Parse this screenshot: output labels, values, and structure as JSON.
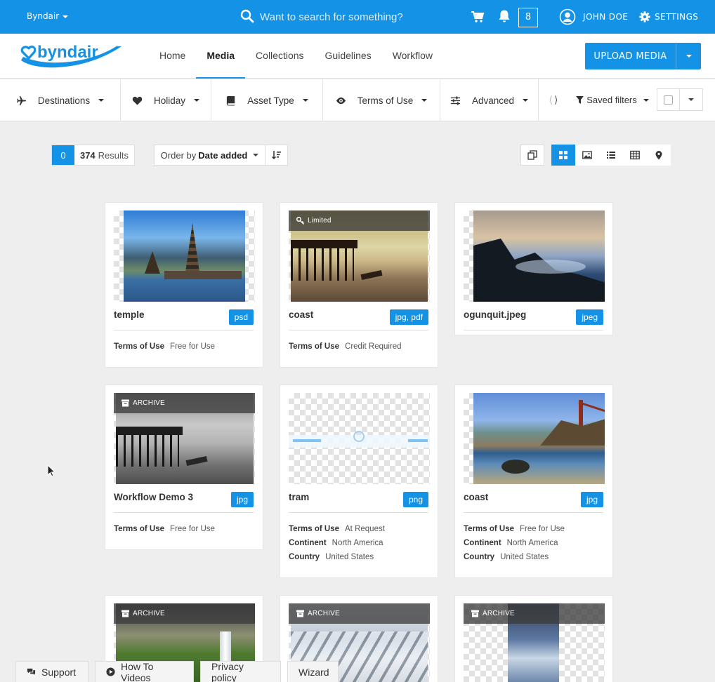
{
  "topbar": {
    "org_name": "Byndair",
    "search_placeholder": "Want to search for something?",
    "notification_count": "8",
    "user_name": "JOHN DOE",
    "settings_label": "SETTINGS",
    "background_color": "#1492e6"
  },
  "navbar": {
    "logo_text": "byndair",
    "items": [
      {
        "label": "Home",
        "active": false
      },
      {
        "label": "Media",
        "active": true
      },
      {
        "label": "Collections",
        "active": false
      },
      {
        "label": "Guidelines",
        "active": false
      },
      {
        "label": "Workflow",
        "active": false
      }
    ],
    "upload_label": "UPLOAD MEDIA"
  },
  "filters": {
    "items": [
      {
        "label": "Destinations",
        "icon": "plane-icon"
      },
      {
        "label": "Holiday",
        "icon": "heart-icon"
      },
      {
        "label": "Asset Type",
        "icon": "book-icon"
      },
      {
        "label": "Terms of Use",
        "icon": "eye-icon"
      },
      {
        "label": "Advanced",
        "icon": "sliders-icon"
      }
    ],
    "saved_label": "Saved filters"
  },
  "results": {
    "selected": "0",
    "count": "374",
    "results_label": "Results",
    "order_prefix": "Order by",
    "order_value": "Date added"
  },
  "cards": [
    {
      "name": "temple",
      "type": "psd",
      "overlay": "",
      "meta": [
        {
          "k": "Terms of Use",
          "v": "Free for Use"
        }
      ]
    },
    {
      "name": "coast",
      "type": "jpg, pdf",
      "overlay": "Limited",
      "meta": [
        {
          "k": "Terms of Use",
          "v": "Credit Required"
        }
      ]
    },
    {
      "name": "ogunquit.jpeg",
      "type": "jpeg",
      "overlay": "",
      "meta": []
    },
    {
      "name": "Workflow Demo 3",
      "type": "jpg",
      "overlay": "ARCHIVE",
      "meta": [
        {
          "k": "Terms of Use",
          "v": "Free for Use"
        }
      ]
    },
    {
      "name": "tram",
      "type": "png",
      "overlay": "",
      "meta": [
        {
          "k": "Terms of Use",
          "v": "At Request"
        },
        {
          "k": "Continent",
          "v": "North America"
        },
        {
          "k": "Country",
          "v": "United States"
        }
      ]
    },
    {
      "name": "coast",
      "type": "jpg",
      "overlay": "",
      "meta": [
        {
          "k": "Terms of Use",
          "v": "Free for Use"
        },
        {
          "k": "Continent",
          "v": "North America"
        },
        {
          "k": "Country",
          "v": "United States"
        }
      ]
    },
    {
      "name": "",
      "type": "",
      "overlay": "ARCHIVE",
      "meta": []
    },
    {
      "name": "",
      "type": "",
      "overlay": "ARCHIVE",
      "meta": []
    },
    {
      "name": "",
      "type": "",
      "overlay": "ARCHIVE",
      "meta": []
    }
  ],
  "footer": {
    "items": [
      {
        "label": "Support",
        "icon": "chat-icon"
      },
      {
        "label": "How To Videos",
        "icon": "play-icon"
      },
      {
        "label": "Privacy policy",
        "icon": ""
      },
      {
        "label": "Wizard",
        "icon": ""
      }
    ]
  }
}
